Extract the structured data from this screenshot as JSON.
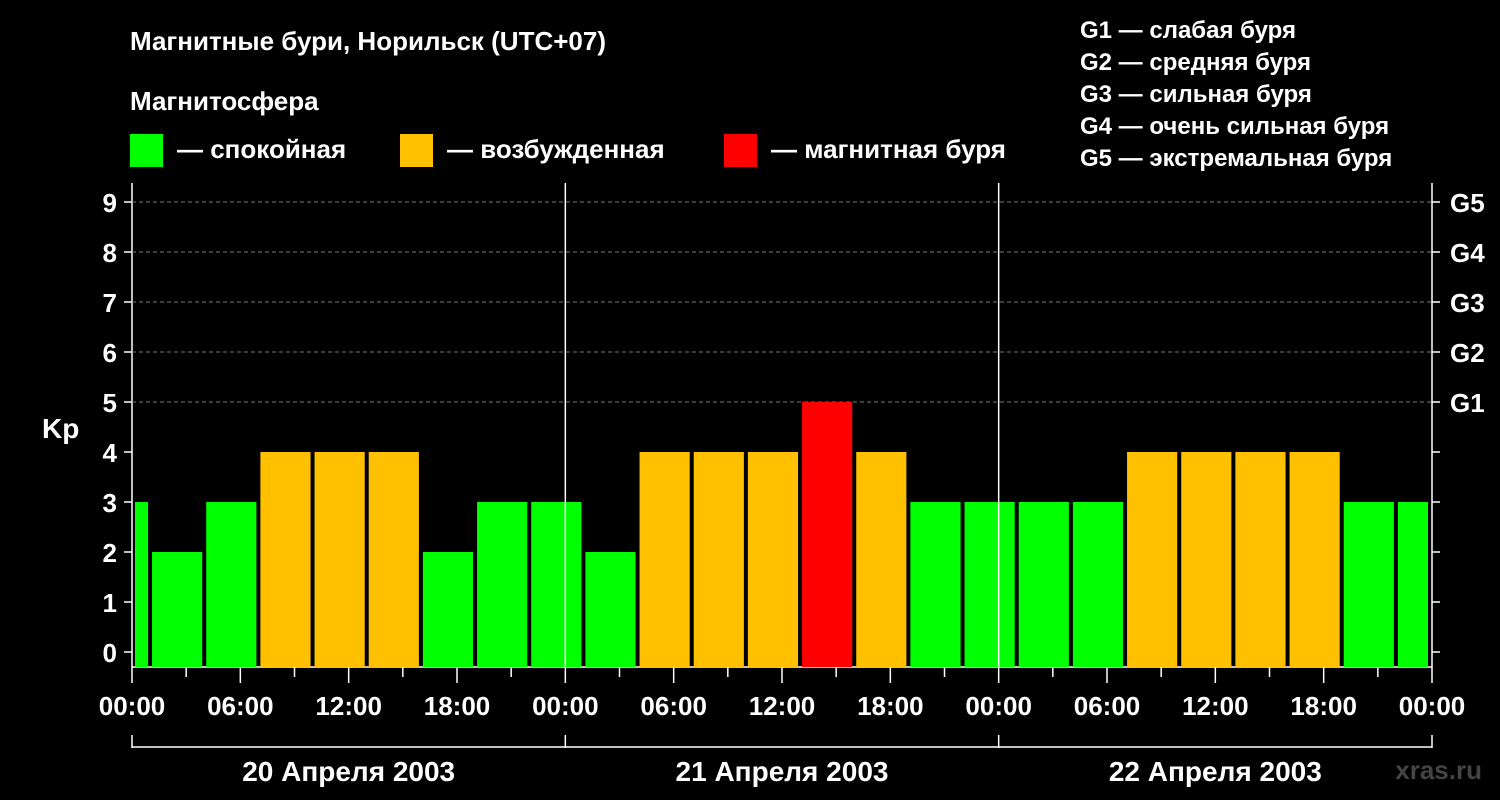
{
  "chart_data": {
    "type": "bar",
    "title": "Магнитные бури, Норильск (UTC+07)",
    "legend_heading": "Магнитосфера",
    "ylabel": "Kp",
    "ylim": [
      0,
      9
    ],
    "yticks": [
      0,
      1,
      2,
      3,
      4,
      5,
      6,
      7,
      8,
      9
    ],
    "legend": [
      {
        "label": "— спокойная",
        "color": "#00ff00"
      },
      {
        "label": "— возбужденная",
        "color": "#ffc000"
      },
      {
        "label": "— магнитная буря",
        "color": "#ff0000"
      }
    ],
    "g_scale": [
      {
        "level": "G1",
        "kp": 5,
        "description": "G1 — слабая буря"
      },
      {
        "level": "G2",
        "kp": 6,
        "description": "G2 — средняя буря"
      },
      {
        "level": "G3",
        "kp": 7,
        "description": "G3 — сильная буря"
      },
      {
        "level": "G4",
        "kp": 8,
        "description": "G4 — очень сильная буря"
      },
      {
        "level": "G5",
        "kp": 9,
        "description": "G5 — экстремальная буря"
      }
    ],
    "x_tick_labels": [
      "00:00",
      "06:00",
      "12:00",
      "18:00",
      "00:00",
      "06:00",
      "12:00",
      "18:00",
      "00:00",
      "06:00",
      "12:00",
      "18:00",
      "00:00"
    ],
    "days": [
      "20 Апреля 2003",
      "21 Апреля 2003",
      "22 Апреля 2003"
    ],
    "bars": [
      {
        "start_hour": 0,
        "end_hour": 1,
        "kp": 3,
        "color": "#00ff00"
      },
      {
        "start_hour": 1,
        "end_hour": 4,
        "kp": 2,
        "color": "#00ff00"
      },
      {
        "start_hour": 4,
        "end_hour": 7,
        "kp": 3,
        "color": "#00ff00"
      },
      {
        "start_hour": 7,
        "end_hour": 10,
        "kp": 4,
        "color": "#ffc000"
      },
      {
        "start_hour": 10,
        "end_hour": 13,
        "kp": 4,
        "color": "#ffc000"
      },
      {
        "start_hour": 13,
        "end_hour": 16,
        "kp": 4,
        "color": "#ffc000"
      },
      {
        "start_hour": 16,
        "end_hour": 19,
        "kp": 2,
        "color": "#00ff00"
      },
      {
        "start_hour": 19,
        "end_hour": 22,
        "kp": 3,
        "color": "#00ff00"
      },
      {
        "start_hour": 22,
        "end_hour": 25,
        "kp": 3,
        "color": "#00ff00"
      },
      {
        "start_hour": 25,
        "end_hour": 28,
        "kp": 2,
        "color": "#00ff00"
      },
      {
        "start_hour": 28,
        "end_hour": 31,
        "kp": 4,
        "color": "#ffc000"
      },
      {
        "start_hour": 31,
        "end_hour": 34,
        "kp": 4,
        "color": "#ffc000"
      },
      {
        "start_hour": 34,
        "end_hour": 37,
        "kp": 4,
        "color": "#ffc000"
      },
      {
        "start_hour": 37,
        "end_hour": 40,
        "kp": 5,
        "color": "#ff0000"
      },
      {
        "start_hour": 40,
        "end_hour": 43,
        "kp": 4,
        "color": "#ffc000"
      },
      {
        "start_hour": 43,
        "end_hour": 46,
        "kp": 3,
        "color": "#00ff00"
      },
      {
        "start_hour": 46,
        "end_hour": 49,
        "kp": 3,
        "color": "#00ff00"
      },
      {
        "start_hour": 49,
        "end_hour": 52,
        "kp": 3,
        "color": "#00ff00"
      },
      {
        "start_hour": 52,
        "end_hour": 55,
        "kp": 3,
        "color": "#00ff00"
      },
      {
        "start_hour": 55,
        "end_hour": 58,
        "kp": 4,
        "color": "#ffc000"
      },
      {
        "start_hour": 58,
        "end_hour": 61,
        "kp": 4,
        "color": "#ffc000"
      },
      {
        "start_hour": 61,
        "end_hour": 64,
        "kp": 4,
        "color": "#ffc000"
      },
      {
        "start_hour": 64,
        "end_hour": 67,
        "kp": 4,
        "color": "#ffc000"
      },
      {
        "start_hour": 67,
        "end_hour": 70,
        "kp": 3,
        "color": "#00ff00"
      },
      {
        "start_hour": 70,
        "end_hour": 72,
        "kp": 3,
        "color": "#00ff00"
      }
    ],
    "grid": true,
    "xrange_hours": [
      0,
      72
    ]
  },
  "watermark": "xras.ru"
}
